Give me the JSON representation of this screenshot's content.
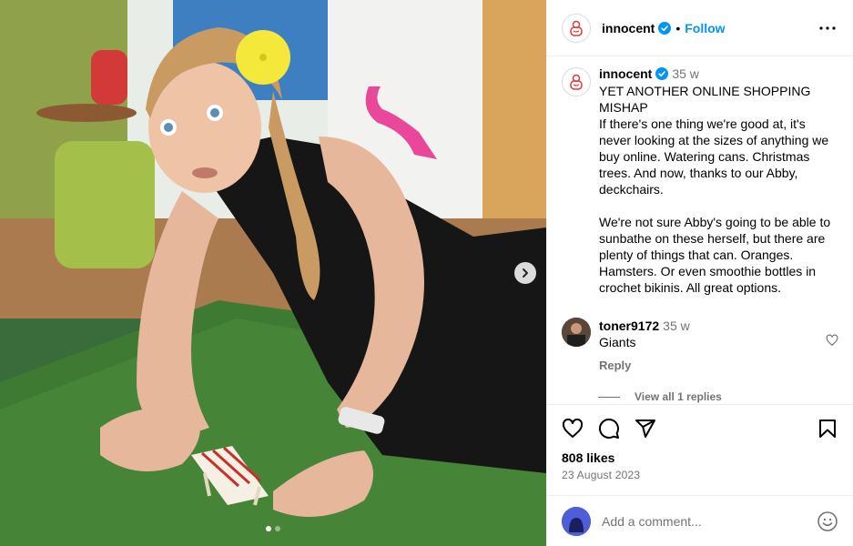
{
  "account": {
    "username": "innocent",
    "follow_label": "Follow",
    "separator": "•"
  },
  "caption": {
    "username": "innocent",
    "time": "35 w",
    "text": "YET ANOTHER ONLINE SHOPPING MISHAP\nIf there's one thing we're good at, it's never looking at the sizes of anything we buy online. Watering cans. Christmas trees. And now, thanks to our Abby, deckchairs.\n\nWe're not sure Abby's going to be able to sunbathe on these herself, but there are plenty of things that can. Oranges. Hamsters. Or even smoothie bottles in crochet bikinis. All great options."
  },
  "comments": [
    {
      "username": "toner9172",
      "time": "35 w",
      "text": "Giants",
      "reply_label": "Reply",
      "view_replies_label": "View all 1 replies"
    }
  ],
  "engagement": {
    "likes": "808 likes",
    "date": "23 August 2023"
  },
  "add_comment": {
    "placeholder": "Add a comment..."
  },
  "carousel": {
    "total_slides": 2,
    "current_slide": 1
  },
  "colors": {
    "accent": "#0095f6",
    "verified": "#0095f6",
    "secondary_text": "#737373",
    "border": "#efefef"
  },
  "icons": [
    "innocent-logo-icon",
    "verified-badge-icon",
    "more-options-icon",
    "next-slide-icon",
    "like-heart-icon",
    "comment-icon",
    "share-icon",
    "save-bookmark-icon",
    "comment-like-heart-icon",
    "emoji-icon"
  ]
}
